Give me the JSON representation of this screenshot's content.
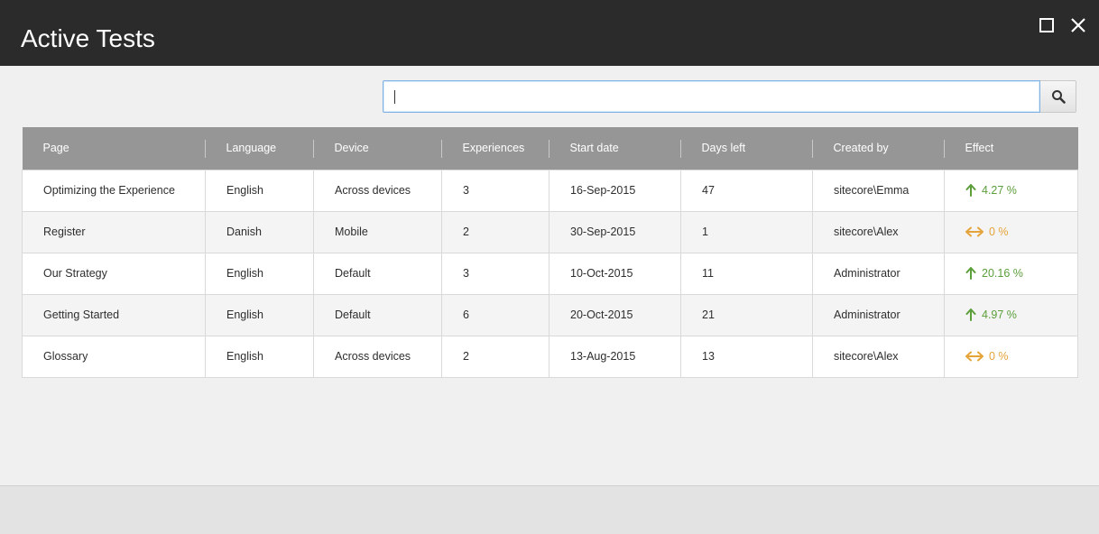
{
  "window": {
    "title": "Active Tests",
    "maximize_icon": "maximize-icon",
    "close_icon": "close-icon"
  },
  "search": {
    "value": "",
    "placeholder": "",
    "button_icon": "search-icon"
  },
  "table": {
    "columns": [
      "Page",
      "Language",
      "Device",
      "Experiences",
      "Start date",
      "Days left",
      "Created by",
      "Effect"
    ],
    "rows": [
      {
        "page": "Optimizing the Experience",
        "language": "English",
        "device": "Across devices",
        "experiences": "3",
        "start_date": "16-Sep-2015",
        "days_left": "47",
        "created_by": "sitecore\\Emma",
        "effect": "4.27 %",
        "trend": "up"
      },
      {
        "page": "Register",
        "language": "Danish",
        "device": "Mobile",
        "experiences": "2",
        "start_date": "30-Sep-2015",
        "days_left": "1",
        "created_by": "sitecore\\Alex",
        "effect": "0 %",
        "trend": "neutral"
      },
      {
        "page": "Our Strategy",
        "language": "English",
        "device": "Default",
        "experiences": "3",
        "start_date": "10-Oct-2015",
        "days_left": "11",
        "created_by": "Administrator",
        "effect": "20.16 %",
        "trend": "up"
      },
      {
        "page": "Getting Started",
        "language": "English",
        "device": "Default",
        "experiences": "6",
        "start_date": "20-Oct-2015",
        "days_left": "21",
        "created_by": "Administrator",
        "effect": "4.97 %",
        "trend": "up"
      },
      {
        "page": "Glossary",
        "language": "English",
        "device": "Across devices",
        "experiences": "2",
        "start_date": "13-Aug-2015",
        "days_left": "13",
        "created_by": "sitecore\\Alex",
        "effect": "0 %",
        "trend": "neutral"
      }
    ]
  },
  "colors": {
    "titlebar": "#2b2b2b",
    "header": "#969696",
    "effect_up": "#5b9e3a",
    "effect_neutral": "#e5a43a"
  }
}
